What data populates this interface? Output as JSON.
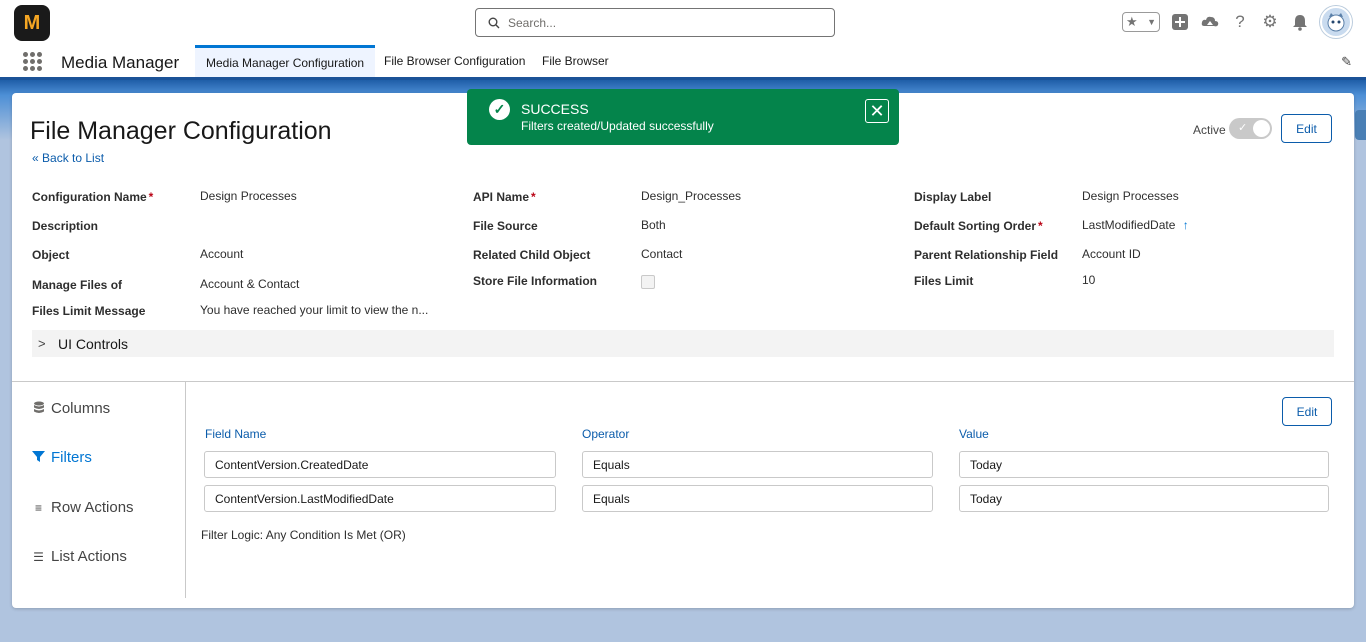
{
  "header": {
    "logo_text": "M",
    "search_placeholder": "Search...",
    "icons": [
      "favorites-star-icon",
      "chevron-down-icon",
      "add-icon",
      "trailhead-icon",
      "help-icon",
      "setup-gear-icon",
      "notifications-bell-icon",
      "avatar"
    ]
  },
  "nav": {
    "app_name": "Media Manager",
    "tabs": [
      {
        "label": "Media Manager Configuration",
        "active": true
      },
      {
        "label": "File Browser Configuration",
        "active": false
      },
      {
        "label": "File Browser",
        "active": false
      }
    ]
  },
  "page": {
    "title": "File Manager Configuration",
    "back_link": "Back to List",
    "active_label": "Active",
    "active_on": true,
    "edit_label": "Edit"
  },
  "fields": {
    "col1": [
      {
        "label": "Configuration Name",
        "required": "*",
        "value": "Design Processes"
      },
      {
        "label": "Description",
        "required": "",
        "value": ""
      },
      {
        "label": "Object",
        "required": "",
        "value": "Account"
      },
      {
        "label": "Manage Files of",
        "required": "",
        "value": "Account & Contact"
      },
      {
        "label": "Files Limit Message",
        "required": "",
        "value": "You have reached your limit to view the n..."
      }
    ],
    "col2": [
      {
        "label": "API Name",
        "required": "*",
        "value": "Design_Processes"
      },
      {
        "label": "File Source",
        "required": "",
        "value": "Both"
      },
      {
        "label": "Related Child Object",
        "required": "",
        "value": "Contact"
      },
      {
        "label": "Store File Information",
        "required": "",
        "value": ""
      }
    ],
    "col3": [
      {
        "label": "Display Label",
        "required": "",
        "value": "Design Processes"
      },
      {
        "label": "Default Sorting Order",
        "required": "*",
        "value": "LastModifiedDate"
      },
      {
        "label": "Parent Relationship Field",
        "required": "",
        "value": "Account ID"
      },
      {
        "label": "Files Limit",
        "required": "",
        "value": "10"
      }
    ]
  },
  "ui_controls_label": "UI Controls",
  "sections": {
    "items": [
      {
        "label": "Columns",
        "icon": "database-icon",
        "active": false
      },
      {
        "label": "Filters",
        "icon": "filter-icon",
        "active": true
      },
      {
        "label": "Row Actions",
        "icon": "lines-icon",
        "active": false
      },
      {
        "label": "List Actions",
        "icon": "list-icon",
        "active": false
      }
    ]
  },
  "filters": {
    "edit_label": "Edit",
    "headers": [
      "Field Name",
      "Operator",
      "Value"
    ],
    "rows": [
      [
        "ContentVersion.CreatedDate",
        "Equals",
        "Today"
      ],
      [
        "ContentVersion.LastModifiedDate",
        "Equals",
        "Today"
      ]
    ],
    "logic": "Filter Logic: Any Condition Is Met (OR)"
  },
  "toast": {
    "title": "SUCCESS",
    "message": "Filters created/Updated successfully",
    "color": "#04844b"
  },
  "colors": {
    "brand_blue": "#0176d3",
    "link_blue": "#0b5cab",
    "required_red": "#ba0517"
  }
}
